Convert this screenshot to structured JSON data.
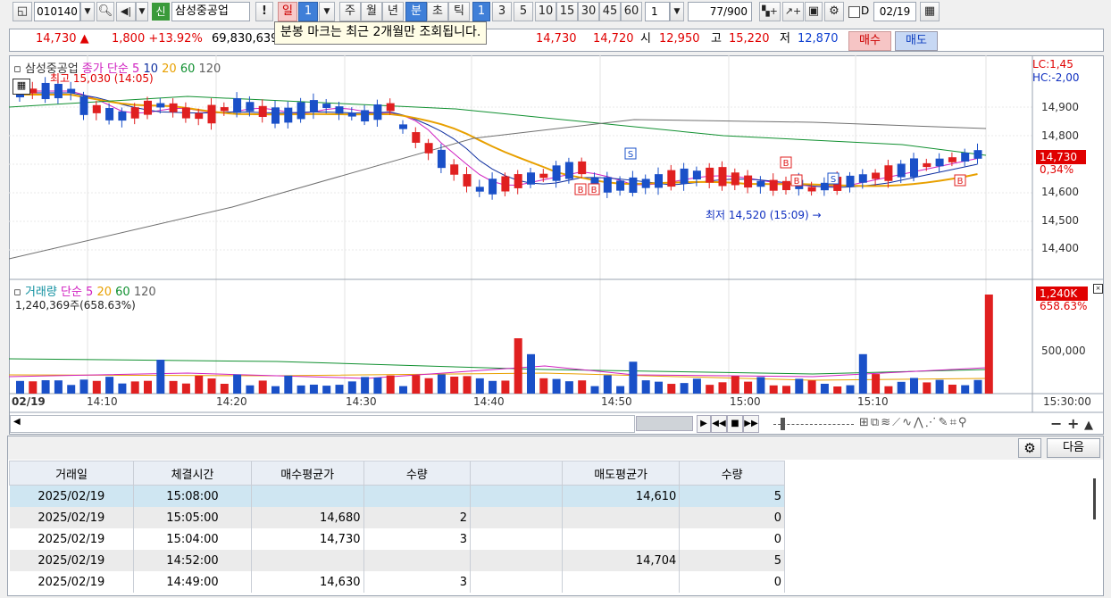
{
  "toolbar": {
    "code": "010140",
    "company_badge": "신",
    "company": "삼성중공업",
    "exclaim": "!",
    "period_day": "일",
    "period_num": "1",
    "periods": [
      "주",
      "월",
      "년",
      "분",
      "초",
      "틱"
    ],
    "minute_options": [
      "1",
      "3",
      "5",
      "10",
      "15",
      "30",
      "45",
      "60"
    ],
    "count_value": "1",
    "counter": "77/900",
    "date_flag": "D",
    "date": "02/19"
  },
  "tooltip": "분봉 마크는 최근 2개월만 조회됩니다.",
  "price_bar": {
    "price": "14,730 ▲",
    "change": "1,800 +13.92%",
    "volume": "69,830,639",
    "ask": "14,730",
    "bid": "14,720",
    "open_label": "시",
    "open": "12,950",
    "high_label": "고",
    "high": "15,220",
    "low_label": "저",
    "low": "12,870",
    "buy": "매수",
    "sell": "매도"
  },
  "chart": {
    "legend_name": "삼성중공업",
    "legend_series": "종가 단순",
    "ma": [
      "5",
      "10",
      "20",
      "60",
      "120"
    ],
    "ma_colors": [
      "#d020c0",
      "#1030a0",
      "#e8a000",
      "#109030",
      "#606060"
    ],
    "high_note": "최고 15,030 (14:05)",
    "low_note": "최저 14,520 (15:09) →",
    "lc": "LC:1,45",
    "hc": "HC:-2,00",
    "cur_price": "14,730",
    "cur_pct": "0,34%",
    "y_ticks": [
      "14,900",
      "14,800",
      "14,700",
      "14,600",
      "14,500",
      "14,400"
    ],
    "vol_legend": "거래량",
    "vol_series": "단순",
    "vol_ma": [
      "5",
      "20",
      "60",
      "120"
    ],
    "vol_info": "1,240,369주(658.63%)",
    "vol_cur": "1,240K",
    "vol_pct": "658.63%",
    "vol_tick": "500,000",
    "x_ticks": [
      "02/19",
      "14:10",
      "14:20",
      "14:30",
      "14:40",
      "14:50",
      "15:00",
      "15:10",
      "15:30:00"
    ]
  },
  "panel": {
    "next": "다음"
  },
  "table": {
    "headers": [
      "거래일",
      "체결시간",
      "매수평균가",
      "수량",
      "",
      "매도평균가",
      "수량"
    ],
    "rows": [
      [
        "2025/02/19",
        "15:08:00",
        "",
        "",
        "",
        "14,610",
        "5"
      ],
      [
        "2025/02/19",
        "15:05:00",
        "14,680",
        "2",
        "",
        "",
        "0"
      ],
      [
        "2025/02/19",
        "15:04:00",
        "14,730",
        "3",
        "",
        "",
        "0"
      ],
      [
        "2025/02/19",
        "14:52:00",
        "",
        "",
        "",
        "14,704",
        "5"
      ],
      [
        "2025/02/19",
        "14:49:00",
        "14,630",
        "3",
        "",
        "",
        "0"
      ]
    ]
  }
}
